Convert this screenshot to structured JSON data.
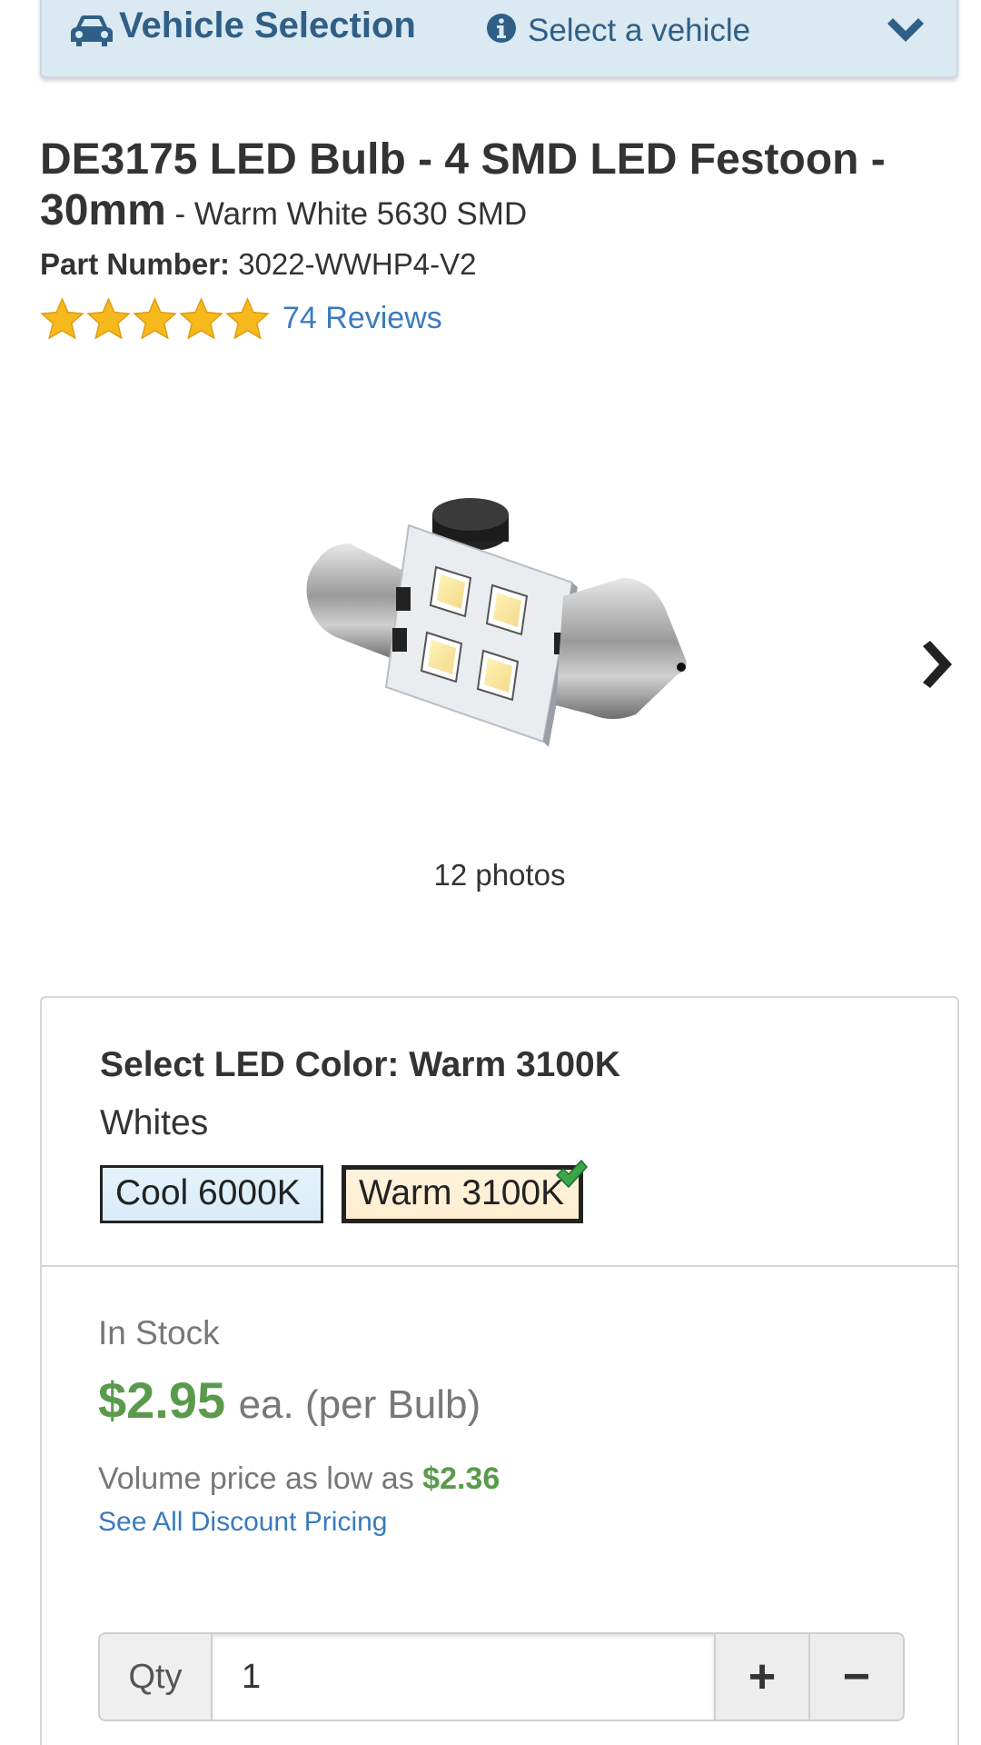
{
  "vehicle_bar": {
    "title": "Vehicle Selection",
    "select_text": "Select a vehicle",
    "icons": {
      "car": "car-icon",
      "info": "info-circle-icon",
      "chevron": "chevron-down-icon"
    }
  },
  "product": {
    "title": "DE3175 LED Bulb - 4 SMD LED Festoon - 30mm",
    "subtitle": " - Warm White 5630 SMD",
    "part_number_label": "Part Number:",
    "part_number": "3022-WWHP4-V2",
    "rating_stars": 5,
    "reviews_text": "74 Reviews",
    "photos_text": "12 photos"
  },
  "options": {
    "color_label": "Select LED Color: Warm 3100K",
    "group_label": "Whites",
    "swatches": [
      "Cool 6000K",
      "Warm 3100K"
    ],
    "selected": "Warm 3100K"
  },
  "pricing": {
    "stock": "In Stock",
    "price": "$2.95",
    "price_unit": "ea. (per Bulb)",
    "volume_text": "Volume price as low as ",
    "volume_price": "$2.36",
    "discount_link": "See All Discount Pricing"
  },
  "qty": {
    "label": "Qty",
    "value": "1",
    "plus": "+",
    "minus": "−"
  },
  "colors": {
    "brand_blue": "#2f5f86",
    "link": "#3a7bbf",
    "price_green": "#5a9a4c",
    "star": "#f6b91d"
  }
}
